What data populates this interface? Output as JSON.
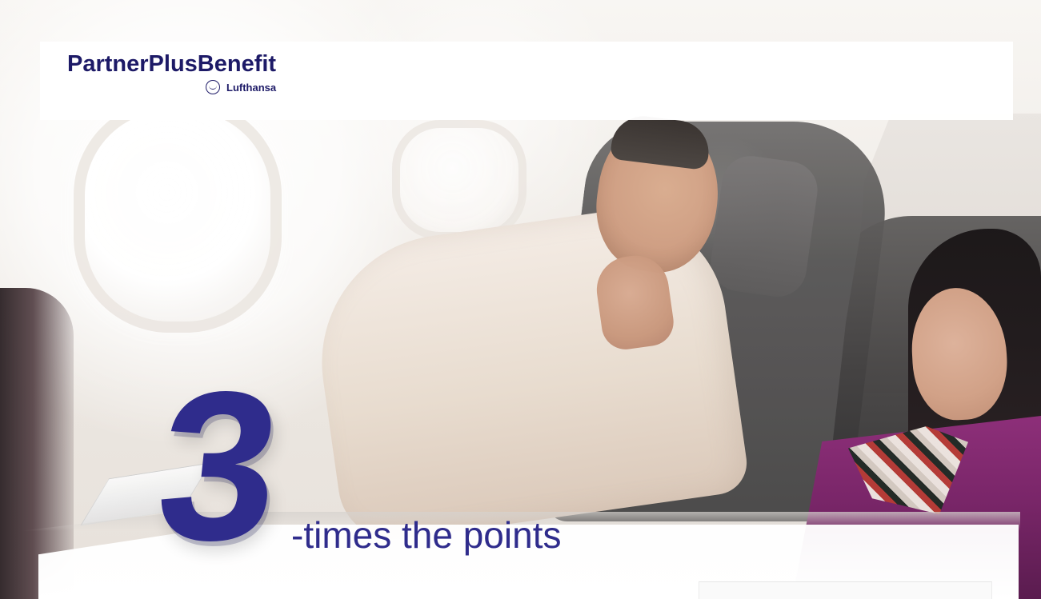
{
  "brand": {
    "title": "PartnerPlusBenefit",
    "subtitle": "Lufthansa"
  },
  "hero": {
    "number": "3",
    "headline": "-times the points"
  },
  "colors": {
    "brand_blue": "#2f2c8c",
    "logo_blue": "#1d1a67",
    "background": "#f5f2ef"
  },
  "icons": {
    "crane": "crane-icon"
  }
}
